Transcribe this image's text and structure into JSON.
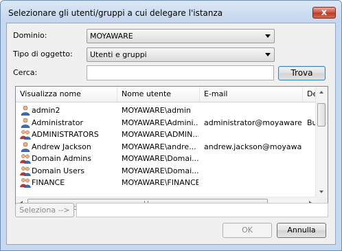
{
  "window": {
    "title": "Selezionare gli utenti/gruppi a cui delegare l'istanza",
    "close_glyph": "x"
  },
  "form": {
    "domain_label": "Dominio:",
    "domain_value": "MOYAWARE",
    "type_label": "Tipo di oggetto:",
    "type_value": "Utenti e gruppi",
    "search_label": "Cerca:",
    "search_value": "",
    "search_button": "Trova"
  },
  "table": {
    "columns": [
      "Visualizza nome",
      "Nome utente",
      "E-mail",
      "Des"
    ],
    "rows": [
      {
        "icon": "user-icon",
        "name": "admin2",
        "username": "MOYAWARE\\admin",
        "email": "",
        "desc": ""
      },
      {
        "icon": "user-icon",
        "name": "Administrator",
        "username": "MOYAWARE\\Admini...",
        "email": "administrator@moyaware...",
        "desc": "Bui"
      },
      {
        "icon": "group-icon",
        "name": "ADMINISTRATORS",
        "username": "MOYAWARE\\ADMIN...",
        "email": "",
        "desc": ""
      },
      {
        "icon": "user-icon",
        "name": "Andrew Jackson",
        "username": "MOYAWARE\\andre...",
        "email": "andrew.jackson@moyawa...",
        "desc": ""
      },
      {
        "icon": "group-icon",
        "name": "Domain Admins",
        "username": "MOYAWARE\\Domai...",
        "email": "",
        "desc": ""
      },
      {
        "icon": "group-icon",
        "name": "Domain Users",
        "username": "MOYAWARE\\Domai...",
        "email": "",
        "desc": ""
      },
      {
        "icon": "group-icon",
        "name": "FINANCE",
        "username": "MOYAWARE\\FINANCE",
        "email": "",
        "desc": ""
      }
    ]
  },
  "selection": {
    "select_button": "Seleziona -->",
    "selected_value": ""
  },
  "footer": {
    "ok_button": "OK",
    "cancel_button": "Annulla"
  }
}
